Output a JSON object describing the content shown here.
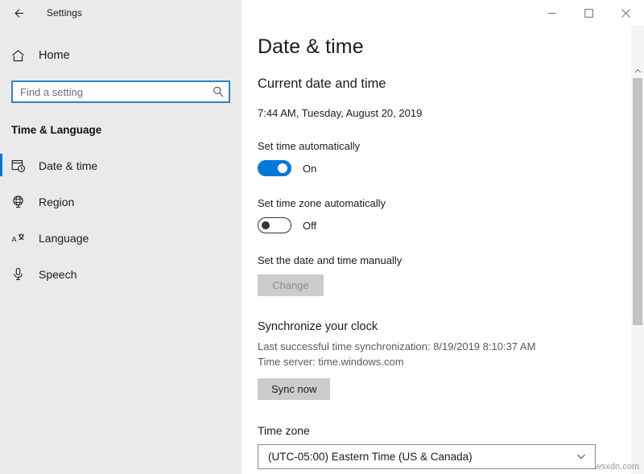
{
  "window": {
    "title": "Settings",
    "back_icon": "back-arrow-icon",
    "minimize_label": "─",
    "maximize_label": "□",
    "close_label": "×"
  },
  "sidebar": {
    "home_label": "Home",
    "home_icon": "home-icon",
    "search": {
      "placeholder": "Find a setting",
      "value": "",
      "icon": "search-icon"
    },
    "group_header": "Time & Language",
    "items": [
      {
        "label": "Date & time",
        "icon": "calendar-clock-icon",
        "selected": true
      },
      {
        "label": "Region",
        "icon": "globe-icon",
        "selected": false
      },
      {
        "label": "Language",
        "icon": "language-icon",
        "selected": false
      },
      {
        "label": "Speech",
        "icon": "microphone-icon",
        "selected": false
      }
    ]
  },
  "main": {
    "page_title": "Date & time",
    "current_section_title": "Current date and time",
    "current_datetime": "7:44 AM, Tuesday, August 20, 2019",
    "set_time_auto": {
      "label": "Set time automatically",
      "state": "On",
      "on": true
    },
    "set_timezone_auto": {
      "label": "Set time zone automatically",
      "state": "Off",
      "on": false
    },
    "manual": {
      "label": "Set the date and time manually",
      "button_label": "Change",
      "button_disabled": true
    },
    "sync": {
      "title": "Synchronize your clock",
      "last_sync": "Last successful time synchronization: 8/19/2019 8:10:37 AM",
      "time_server": "Time server: time.windows.com",
      "button_label": "Sync now"
    },
    "timezone": {
      "label": "Time zone",
      "selected": "(UTC-05:00) Eastern Time (US & Canada)",
      "chevron_icon": "chevron-down-icon"
    }
  },
  "scrollbar": {
    "up_arrow_icon": "chevron-up-icon"
  },
  "watermark": "wsxdn.com",
  "colors": {
    "accent": "#0078d7",
    "sidebar_bg": "#eaeaea",
    "content_bg": "#ffffff",
    "button_bg": "#cccccc",
    "muted_text": "#5a5a5a"
  }
}
